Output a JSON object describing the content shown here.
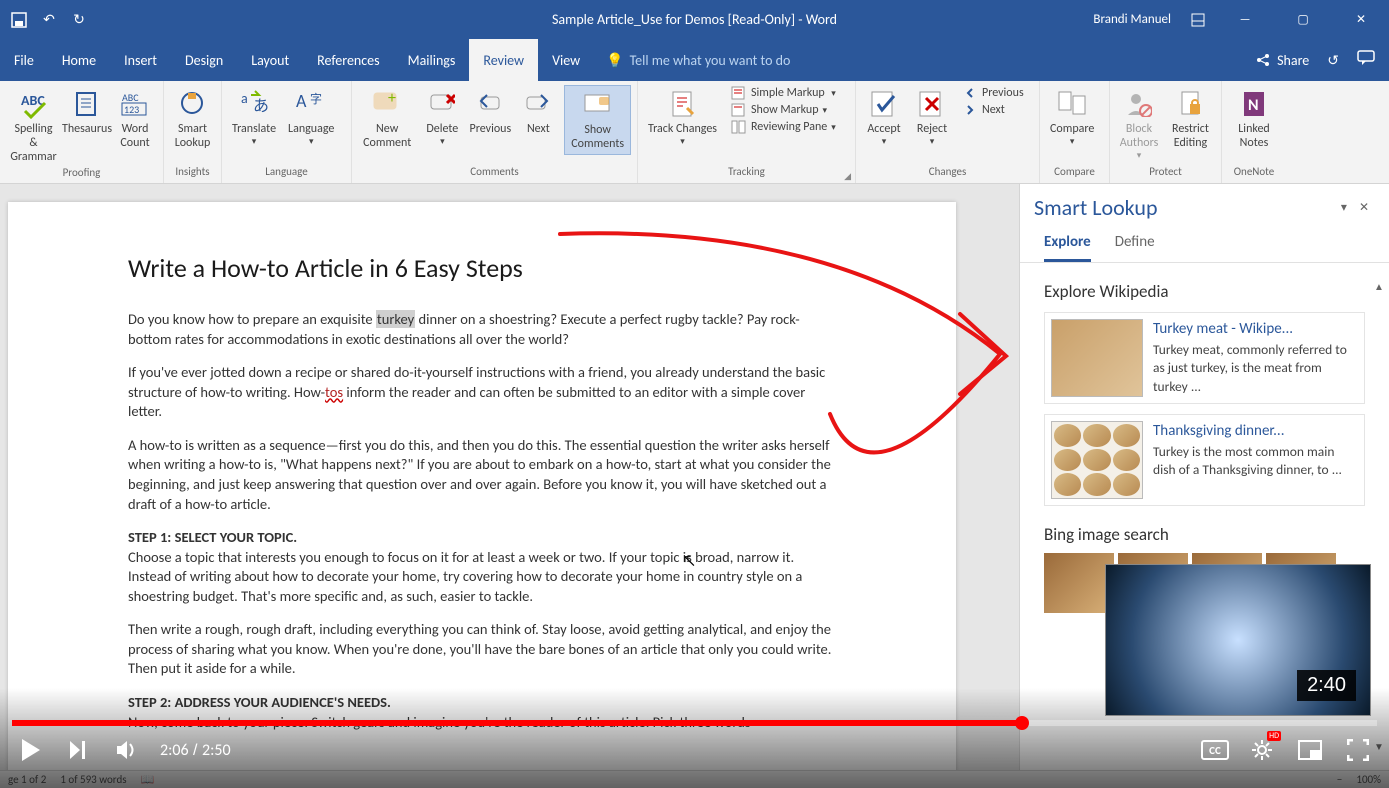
{
  "titlebar": {
    "doc_title": "Sample Article_Use for Demos [Read-Only] - Word",
    "user": "Brandi Manuel"
  },
  "menu": {
    "file": "File",
    "tabs": [
      "Home",
      "Insert",
      "Design",
      "Layout",
      "References",
      "Mailings",
      "Review",
      "View"
    ],
    "active": "Review",
    "tellme_placeholder": "Tell me what you want to do",
    "share": "Share"
  },
  "ribbon": {
    "proofing": {
      "label": "Proofing",
      "spelling": "Spelling & Grammar",
      "thesaurus": "Thesaurus",
      "wordcount": "Word Count"
    },
    "insights": {
      "label": "Insights",
      "smartlookup": "Smart Lookup"
    },
    "language": {
      "label": "Language",
      "translate": "Translate",
      "language": "Language"
    },
    "comments": {
      "label": "Comments",
      "new": "New Comment",
      "delete": "Delete",
      "previous": "Previous",
      "next": "Next",
      "show": "Show Comments"
    },
    "tracking": {
      "label": "Tracking",
      "track": "Track Changes",
      "simple": "Simple Markup",
      "showmk": "Show Markup",
      "revpane": "Reviewing Pane"
    },
    "changes": {
      "label": "Changes",
      "accept": "Accept",
      "reject": "Reject",
      "previous": "Previous",
      "next": "Next"
    },
    "compare": {
      "label": "Compare",
      "compare": "Compare"
    },
    "protect": {
      "label": "Protect",
      "block": "Block Authors",
      "restrict": "Restrict Editing"
    },
    "onenote": {
      "label": "OneNote",
      "linked": "Linked Notes"
    }
  },
  "document": {
    "title": "Write a How-to Article in 6 Easy Steps",
    "p1a": "Do you know how to prepare an exquisite ",
    "p1_hl": "turkey",
    "p1b": " dinner on a shoestring? Execute a perfect rugby tackle? Pay rock-bottom rates for accommodations in exotic destinations all over the world?",
    "p2a": "If you've ever jotted down a recipe or shared do-it-yourself instructions with a friend, you already understand the basic structure of how-to writing. How-",
    "p2_err": "tos",
    "p2b": " inform the reader and can often be submitted to an editor with a simple cover letter.",
    "p3": "A how-to is written as a sequence—first you do this, and then you do this. The essential question the writer asks herself when writing a how-to is, \"What happens next?\" If you are about to embark on a how-to, start at what you consider the beginning, and just keep answering that question over and over again. Before you know it, you will have sketched out a draft of a how-to article.",
    "step1_h": "STEP 1: SELECT YOUR TOPIC.",
    "step1_p1": "Choose a topic that interests you enough to focus on it for at least a week or two. If your topic is broad, narrow it. Instead of writing about how to decorate your home, try covering how to decorate your home in country style on a shoestring budget. That's more specific and, as such, easier to tackle.",
    "step1_p2": "Then write a rough, rough draft, including everything you can think of. Stay loose, avoid getting analytical, and enjoy the process of sharing what you know. When you're done, you'll have the bare bones of an article that only you could write. Then put it aside for a while.",
    "step2_h": "STEP 2: ADDRESS YOUR AUDIENCE'S NEEDS.",
    "step2_p": "Now, come back to your piece. Switch gears and imagine you're the reader of this article. Pick three words"
  },
  "pane": {
    "title": "Smart Lookup",
    "tab_explore": "Explore",
    "tab_define": "Define",
    "sec_wiki": "Explore Wikipedia",
    "card1_title": "Turkey meat - Wikipe...",
    "card1_body": "Turkey meat, commonly referred to as just turkey, is the meat from turkey ...",
    "card2_title": "Thanksgiving dinner...",
    "card2_body": "Turkey is the most common main dish of a Thanksgiving dinner, to ...",
    "sec_bing": "Bing image search"
  },
  "video": {
    "preview_ts": "2:40",
    "current": "2:06",
    "total": "2:50"
  },
  "statusbar": {
    "page": "ge 1 of 2",
    "words": "1 of 593 words",
    "zoom": "100%"
  }
}
